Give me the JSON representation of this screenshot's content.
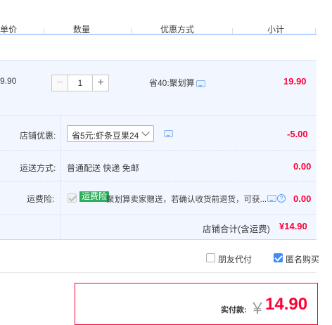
{
  "table_header": {
    "price": "单价",
    "quantity": "数量",
    "discount_method": "优惠方式",
    "subtotal": "小计"
  },
  "item": {
    "price": "9.90",
    "quantity": "1",
    "minus_label": "−",
    "plus_label": "+",
    "promo": "省40:聚划算",
    "subtotal": "19.90"
  },
  "shop_discount": {
    "label": "店铺优惠:",
    "selected": "省5元:虾条豆果24",
    "amount": "-5.00"
  },
  "shipping": {
    "label": "运送方式:",
    "value": "普通配送 快递 免邮",
    "amount": "0.00"
  },
  "insurance": {
    "label": "运费险:",
    "badge": "运费险",
    "text": "聚划算卖家赠送，若确认收货前退货，可获...",
    "amount": "0.00"
  },
  "shop_total": {
    "label": "店铺合计(含运费)",
    "amount": "¥14.90"
  },
  "options": {
    "friend_pay": "朋友代付",
    "anonymous": "匿名购买"
  },
  "payment": {
    "label": "实付款:",
    "currency": "￥",
    "amount": "14.90"
  },
  "colors": {
    "accent_red": "#ff0036",
    "panel_bg": "#f2f7ff",
    "badge_green": "#2eae5b",
    "checkbox_blue": "#3d8cfa"
  }
}
